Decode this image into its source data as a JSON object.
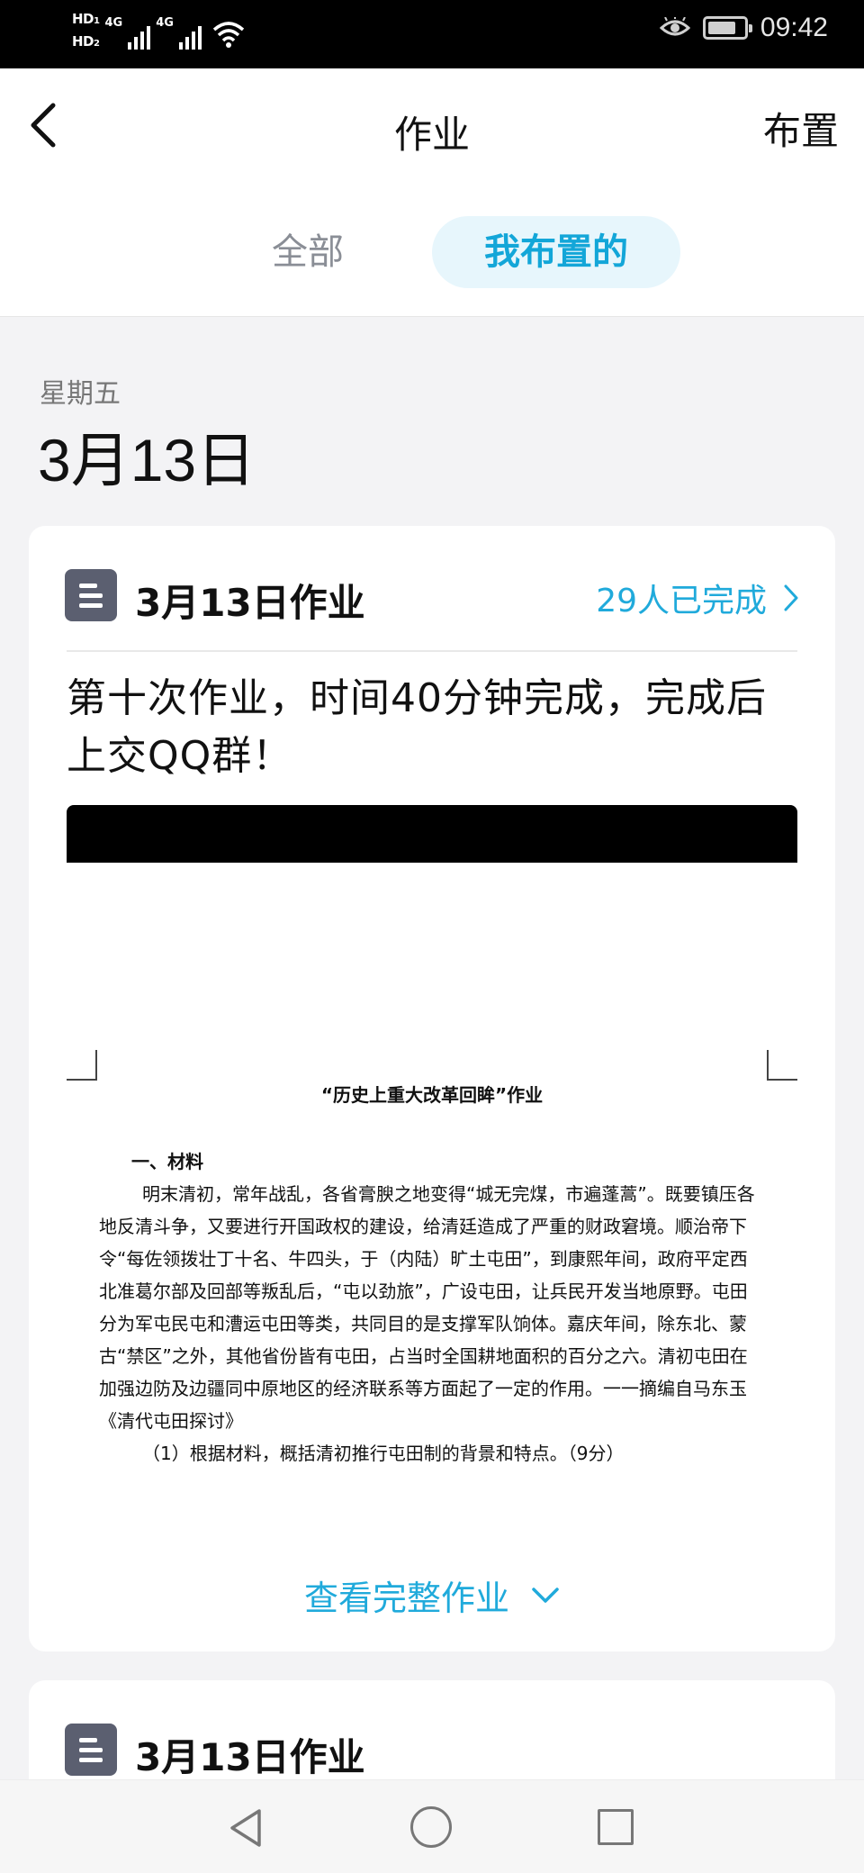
{
  "status_bar": {
    "sim1": "HD",
    "sim1_index": "1",
    "sim2": "HD",
    "sim2_index": "2",
    "network1": "4G",
    "network2": "4G",
    "time": "09:42",
    "icons": [
      "signal-icon",
      "wifi-icon",
      "eye-icon",
      "battery-icon"
    ]
  },
  "header": {
    "back_icon": "chevron-left-icon",
    "title": "作业",
    "action_label": "布置",
    "tabs": [
      {
        "label": "全部",
        "active": false
      },
      {
        "label": "我布置的",
        "active": true
      }
    ]
  },
  "date_group": {
    "weekday": "星期五",
    "date": "3月13日"
  },
  "cards": [
    {
      "icon": "document-icon",
      "title": "3月13日作业",
      "completion": "29人已完成",
      "description": "第十次作业，时间40分钟完成，完成后上交QQ群！",
      "document": {
        "title": "“历史上重大改革回眸”作业",
        "section": "一、材料",
        "paragraph": "明末清初，常年战乱，各省膏腴之地变得“城无完煤，市遍蓬蒿”。既要镇压各地反清斗争，又要进行开国政权的建设，给清廷造成了严重的财政窘境。顺治帝下令“每佐领拨壮丁十名、牛四头，于（内陆）旷土屯田”，到康熙年间，政府平定西北准葛尔部及回部等叛乱后，“屯以劲旅”，广设屯田，让兵民开发当地原野。屯田分为军屯民屯和漕运屯田等类，共同目的是支撑军队饷体。嘉庆年间，除东北、蒙古“禁区”之外，其他省份皆有屯田，占当时全国耕地面积的百分之六。清初屯田在加强边防及边疆同中原地区的经济联系等方面起了一定的作用。一一摘编自马东玉《清代屯田探讨》",
        "question": "（1）根据材料，概括清初推行屯田制的背景和特点。（9分）"
      },
      "view_full_label": "查看完整作业",
      "expand_icon": "chevron-down-icon"
    },
    {
      "icon": "document-icon",
      "title": "3月13日作业"
    }
  ],
  "nav_bar": {
    "icons": [
      "nav-back-icon",
      "nav-home-icon",
      "nav-recent-icon"
    ]
  },
  "colors": {
    "accent": "#20aadb",
    "tab_active_bg": "#e7f6fc",
    "icon_bg": "#5b5f70",
    "page_bg": "#f3f3f5"
  }
}
